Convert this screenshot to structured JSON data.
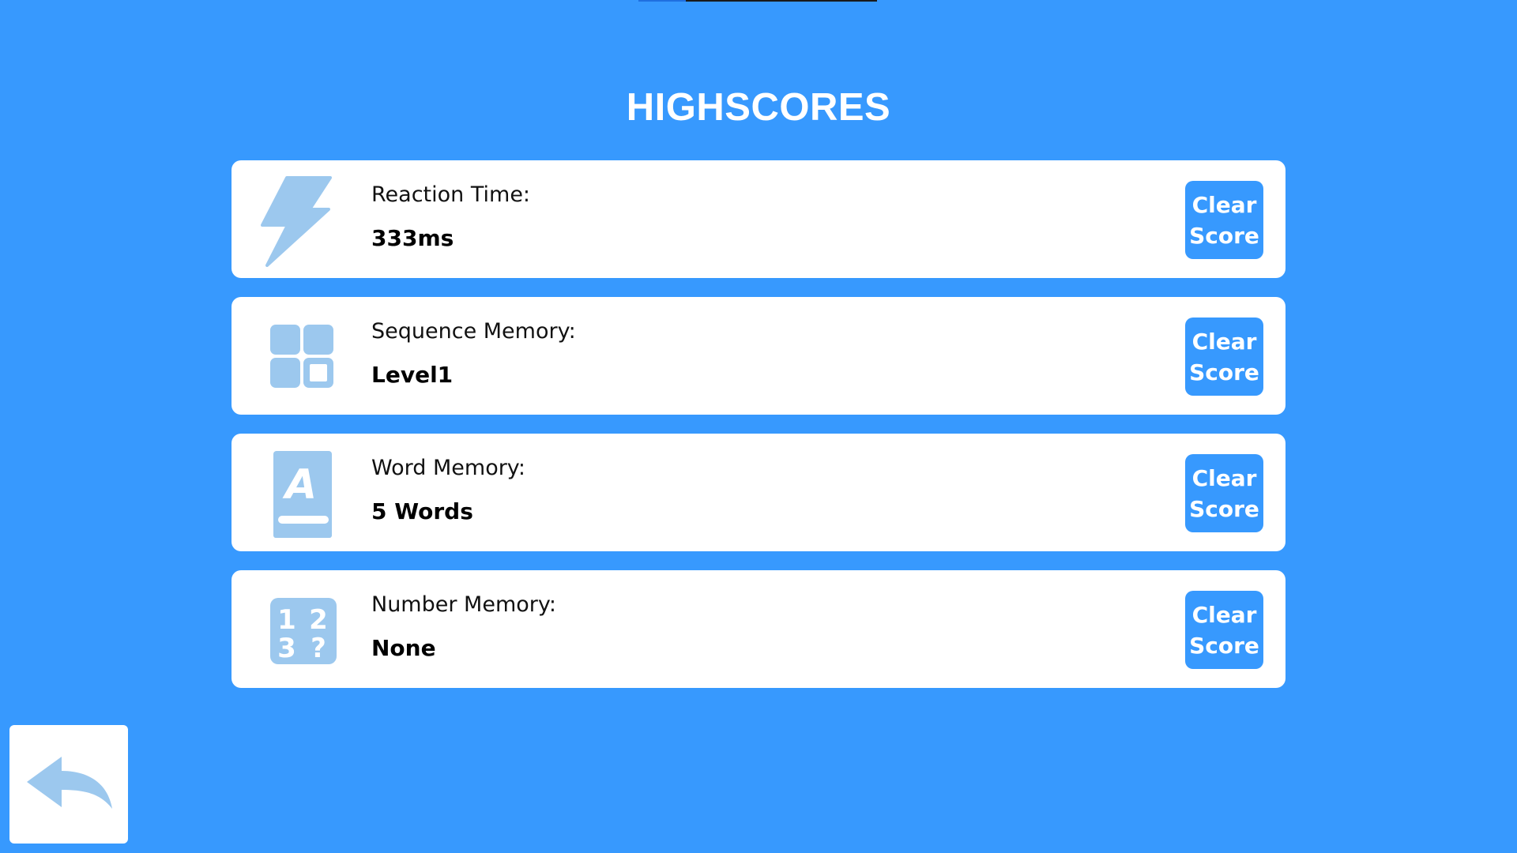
{
  "page": {
    "title": "HIGHSCORES"
  },
  "colors": {
    "background": "#3799fe",
    "card": "#ffffff",
    "icon": "#9cc8ee",
    "button": "#3799fe",
    "button_text": "#ffffff"
  },
  "scores": [
    {
      "label": "Reaction Time:",
      "value": "333ms",
      "icon": "lightning-icon",
      "button_label": "Clear Score"
    },
    {
      "label": "Sequence Memory:",
      "value": "Level1",
      "icon": "grid-icon",
      "button_label": "Clear Score"
    },
    {
      "label": "Word Memory:",
      "value": "5 Words",
      "icon": "book-letter-icon",
      "button_label": "Clear Score"
    },
    {
      "label": "Number Memory:",
      "value": "None",
      "icon": "numbers-icon",
      "button_label": "Clear Score"
    }
  ],
  "back_button": {
    "icon": "back-arrow-icon"
  }
}
